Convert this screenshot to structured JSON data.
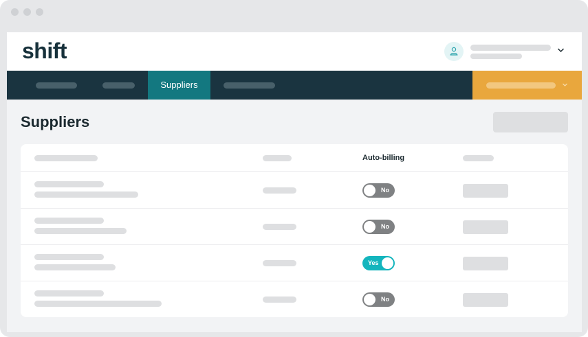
{
  "app": {
    "logo_text": "shift"
  },
  "nav": {
    "active_tab_label": "Suppliers"
  },
  "page": {
    "title": "Suppliers"
  },
  "table": {
    "column_headers": [
      "",
      "",
      "Auto-billing",
      ""
    ],
    "rows": [
      {
        "auto_billing": "No",
        "auto_billing_on": false
      },
      {
        "auto_billing": "No",
        "auto_billing_on": false
      },
      {
        "auto_billing": "Yes",
        "auto_billing_on": true
      },
      {
        "auto_billing": "No",
        "auto_billing_on": false
      }
    ]
  },
  "colors": {
    "nav_bg": "#1a3440",
    "nav_active": "#137880",
    "accent_cta": "#e9a73d",
    "toggle_on": "#14b5bd",
    "toggle_off": "#7f8183"
  },
  "icons": {
    "user": "user-icon",
    "dropdown": "chevron-down-icon"
  }
}
